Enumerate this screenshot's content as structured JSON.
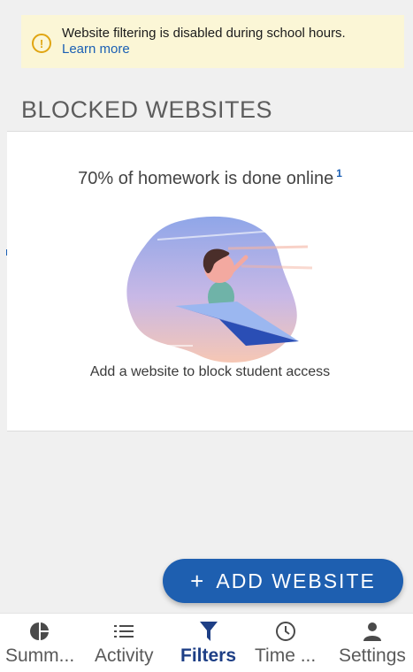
{
  "notice": {
    "message": "Website filtering is disabled during school hours.",
    "link": "Learn more",
    "icon": "warning-icon"
  },
  "section_title": "BLOCKED WEBSITES",
  "empty_state": {
    "stat_text": "70% of homework is done online",
    "footnote": "1",
    "caption": "Add a website to block student access"
  },
  "fab": {
    "plus": "+",
    "label": "ADD WEBSITE"
  },
  "tabs": [
    {
      "label": "Summ...",
      "icon": "pie-chart-icon",
      "active": false
    },
    {
      "label": "Activity",
      "icon": "list-icon",
      "active": false
    },
    {
      "label": "Filters",
      "icon": "filter-icon",
      "active": true
    },
    {
      "label": "Time ...",
      "icon": "clock-icon",
      "active": false
    },
    {
      "label": "Settings",
      "icon": "person-icon",
      "active": false
    }
  ],
  "colors": {
    "accent": "#1e5fb0",
    "active_tab": "#1e3f86",
    "notice_bg": "#fbf6d6",
    "warning": "#e0a512"
  }
}
